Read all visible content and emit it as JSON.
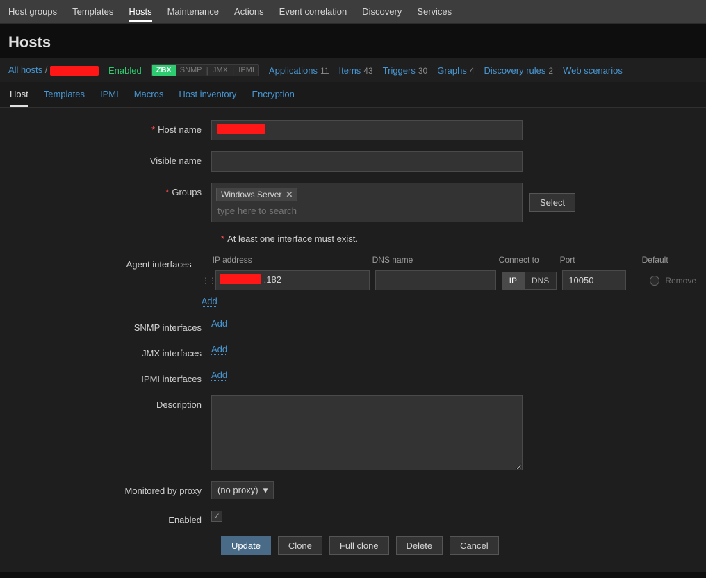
{
  "topnav": {
    "items": [
      "Host groups",
      "Templates",
      "Hosts",
      "Maintenance",
      "Actions",
      "Event correlation",
      "Discovery",
      "Services"
    ],
    "active": "Hosts"
  },
  "page": {
    "title": "Hosts"
  },
  "crumb": {
    "all_hosts": "All hosts",
    "slash": "/",
    "enabled": "Enabled",
    "proto": {
      "zbx": "ZBX",
      "snmp": "SNMP",
      "jmx": "JMX",
      "ipmi": "IPMI"
    },
    "links": [
      {
        "label": "Applications",
        "count": "11"
      },
      {
        "label": "Items",
        "count": "43"
      },
      {
        "label": "Triggers",
        "count": "30"
      },
      {
        "label": "Graphs",
        "count": "4"
      },
      {
        "label": "Discovery rules",
        "count": "2"
      },
      {
        "label": "Web scenarios",
        "count": ""
      }
    ]
  },
  "subtabs": {
    "items": [
      "Host",
      "Templates",
      "IPMI",
      "Macros",
      "Host inventory",
      "Encryption"
    ],
    "active": "Host"
  },
  "form": {
    "host_name_label": "Host name",
    "host_name_value": "",
    "visible_name_label": "Visible name",
    "visible_name_value": "",
    "groups_label": "Groups",
    "groups_tag": "Windows Server",
    "groups_placeholder": "type here to search",
    "select_btn": "Select",
    "iface_hint": "At least one interface must exist.",
    "agent_label": "Agent interfaces",
    "cols": {
      "ip": "IP address",
      "dns": "DNS name",
      "conn": "Connect to",
      "port": "Port",
      "def": "Default"
    },
    "agent_row": {
      "ip_suffix": ".182",
      "dns": "",
      "ip_btn": "IP",
      "dns_btn": "DNS",
      "port": "10050",
      "remove": "Remove"
    },
    "add": "Add",
    "snmp_label": "SNMP interfaces",
    "jmx_label": "JMX interfaces",
    "ipmi_label": "IPMI interfaces",
    "desc_label": "Description",
    "desc_value": "",
    "proxy_label": "Monitored by proxy",
    "proxy_value": "(no proxy)",
    "enabled_label": "Enabled",
    "buttons": {
      "update": "Update",
      "clone": "Clone",
      "full_clone": "Full clone",
      "delete": "Delete",
      "cancel": "Cancel"
    }
  }
}
